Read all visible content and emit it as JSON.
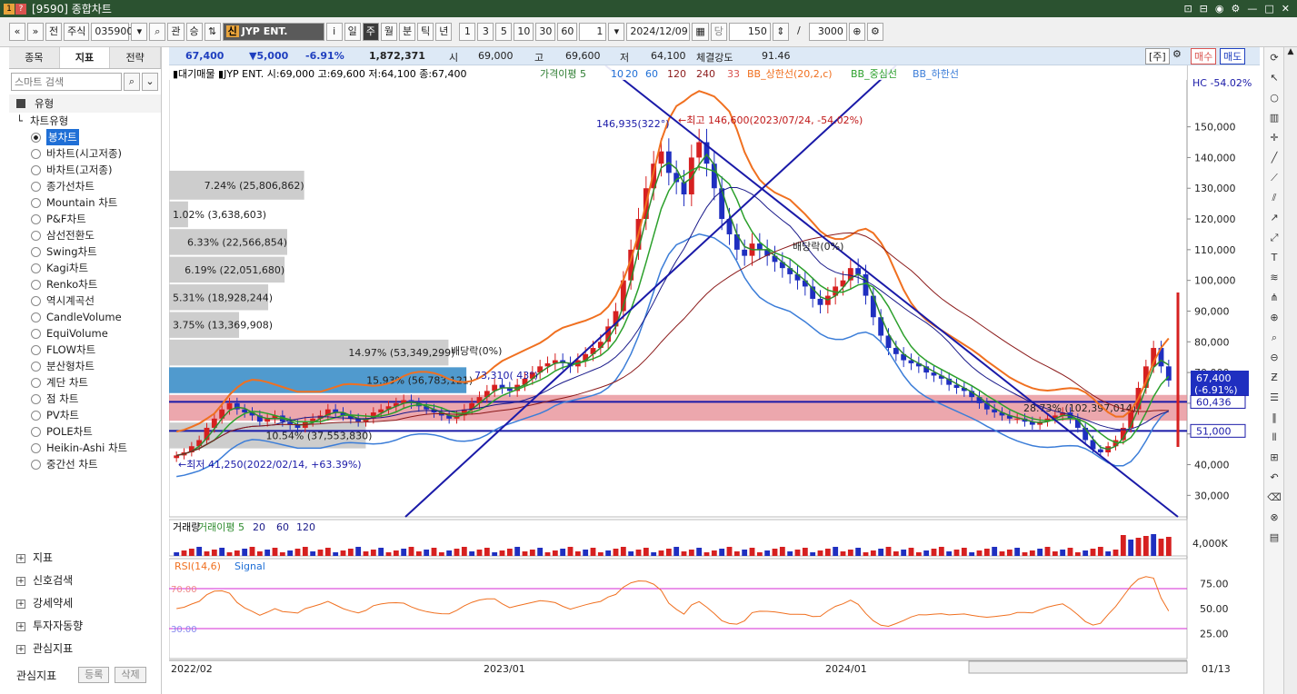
{
  "window": {
    "title": "[9590] 종합차트",
    "num1": "1",
    "num2": "?"
  },
  "toolbar": {
    "items": [
      "«",
      "»",
      "전",
      "주식",
      "035900",
      "▾",
      "⌕",
      "관",
      "승",
      "⇅",
      "",
      "i",
      "일",
      "주",
      "월",
      "분",
      "틱",
      "년",
      "1",
      "3",
      "5",
      "10",
      "30",
      "60",
      "1",
      "▾",
      "2024/12/09",
      "▦",
      "당",
      "150",
      "⇕",
      "/",
      "3000",
      "⊕",
      "⚙"
    ],
    "stock_tag": "신",
    "stock_name": "JYP ENT."
  },
  "left": {
    "tabs": [
      "종목",
      "지표",
      "전략"
    ],
    "search_placeholder": "스마트 검색",
    "section": "유형",
    "subsection": "차트유형",
    "chart_types": [
      "봉차트",
      "바차트(시고저종)",
      "바차트(고저종)",
      "종가선차트",
      "Mountain 차트",
      "P&F차트",
      "삼선전환도",
      "Swing차트",
      "Kagi차트",
      "Renko차트",
      "역시계곡선",
      "CandleVolume",
      "EquiVolume",
      "FLOW차트",
      "분산형차트",
      "계단 차트",
      "점 차트",
      "PV차트",
      "POLE차트",
      "Heikin-Ashi 차트",
      "중간선 차트"
    ],
    "bottom_sections": [
      "지표",
      "신호검색",
      "강세약세",
      "투자자동향",
      "관심지표"
    ],
    "bottom_label": "관심지표",
    "bottom_buttons": [
      "등록",
      "삭제"
    ]
  },
  "info": {
    "price": "67,400",
    "change": "▼5,000",
    "pct": "-6.91%",
    "volume": "1,872,371",
    "open_lbl": "시",
    "open": "69,000",
    "high_lbl": "고",
    "high": "69,600",
    "low_lbl": "저",
    "low": "64,100",
    "strength_lbl": "체결강도",
    "strength": "91.46",
    "unit_lbl": "[주]",
    "buy": "매수",
    "sell": "매도"
  },
  "chart_data": {
    "type": "candlestick",
    "legend_main": "▮대기매물 ▮JYP ENT. 시:69,000 고:69,600 저:64,100 종:67,400",
    "legend_ma": [
      "가격이평 5",
      "10",
      "20",
      "60",
      "120",
      "240",
      "33",
      "BB_상한선(20,2,c)",
      "BB_중심선",
      "BB_하한선"
    ],
    "ma_colors": [
      "#2e7d32",
      "#1f6fd6",
      "#1f6fd6",
      "#1f6fd6",
      "#8b1a1a",
      "#8b1a1a",
      "#d9534f",
      "#f07020",
      "#2ca02c",
      "#3b7dd8"
    ],
    "x_ticks": [
      "2022/02",
      "2023/01",
      "2024/01",
      "01/13"
    ],
    "y_ticks": [
      150000,
      140000,
      130000,
      120000,
      110000,
      100000,
      90000,
      80000,
      70000,
      60000,
      50000,
      40000,
      30000
    ],
    "y_tick_labels": [
      "150,000",
      "140,000",
      "130,000",
      "120,000",
      "110,000",
      "100,000",
      "90,000",
      "80,000",
      "70,000",
      "60,000",
      "50,000",
      "40,000",
      "30,000"
    ],
    "ylim": [
      23000,
      170000
    ],
    "volume_profile": [
      {
        "price_hi": 136000,
        "price_lo": 126000,
        "label": "7.24% (25,806,862)"
      },
      {
        "price_hi": 126000,
        "price_lo": 117000,
        "label": "1.02% (3,638,603)"
      },
      {
        "price_hi": 117000,
        "price_lo": 108000,
        "label": "6.33% (22,566,854)"
      },
      {
        "price_hi": 108000,
        "price_lo": 99000,
        "label": "6.19% (22,051,680)"
      },
      {
        "price_hi": 99000,
        "price_lo": 90000,
        "label": "5.31% (18,928,244)"
      },
      {
        "price_hi": 90000,
        "price_lo": 81000,
        "label": "3.75% (13,369,908)"
      },
      {
        "price_hi": 81000,
        "price_lo": 72000,
        "label": "14.97% (53,349,299)"
      },
      {
        "price_hi": 72000,
        "price_lo": 63000,
        "label": "15.93% (56,783,121)"
      },
      {
        "price_hi": 63000,
        "price_lo": 54000,
        "label": "28.73% (102,397,014)"
      },
      {
        "price_hi": 54000,
        "price_lo": 45000,
        "label": "10.54% (37,553,830)"
      }
    ],
    "annotations": {
      "high_label": "←최고 146,600(2023/07/24, -54.02%)",
      "low_label": "←최저 41,250(2022/02/14, +63.39%)",
      "line_label": "146,935(322°)",
      "line_label2": "73,310( 43°)",
      "div1": "배당락(0%)",
      "div2": "배당락(0%)",
      "hc_label": "HC -54.02%",
      "level1": "60,436",
      "level2": "51,000",
      "cur_price": "67,400",
      "cur_pct": "(-6.91%)"
    },
    "candles": [
      43,
      44,
      46,
      48,
      52,
      55,
      58,
      60,
      58,
      57,
      56,
      54,
      55,
      56,
      54,
      53,
      52,
      54,
      55,
      56,
      58,
      57,
      56,
      55,
      54,
      55,
      57,
      58,
      59,
      60,
      61,
      60,
      59,
      58,
      57,
      56,
      55,
      56,
      58,
      60,
      62,
      64,
      66,
      65,
      64,
      66,
      68,
      70,
      72,
      73,
      74,
      73,
      72,
      74,
      76,
      78,
      80,
      85,
      90,
      100,
      110,
      120,
      130,
      138,
      142,
      135,
      132,
      128,
      140,
      145,
      138,
      130,
      120,
      115,
      110,
      108,
      112,
      110,
      108,
      106,
      104,
      102,
      100,
      98,
      94,
      92,
      95,
      98,
      100,
      104,
      102,
      95,
      88,
      82,
      78,
      76,
      74,
      73,
      72,
      70,
      69,
      68,
      66,
      65,
      64,
      62,
      60,
      58,
      57,
      56,
      55,
      55,
      54,
      53,
      54,
      55,
      56,
      57,
      55,
      52,
      48,
      45,
      44,
      46,
      48,
      52,
      58,
      65,
      72,
      78,
      72,
      67.4
    ],
    "volume_title": "거래량",
    "volume_legend": [
      "거래이평 5",
      "20",
      "60",
      "120"
    ],
    "volume_tick": "4,000K",
    "rsi_legend": [
      "RSI(14,6)",
      "Signal"
    ],
    "rsi_ticks": [
      "75.00",
      "50.00",
      "25.00"
    ],
    "rsi_levels_labels": [
      "70.00",
      "30.00"
    ]
  }
}
